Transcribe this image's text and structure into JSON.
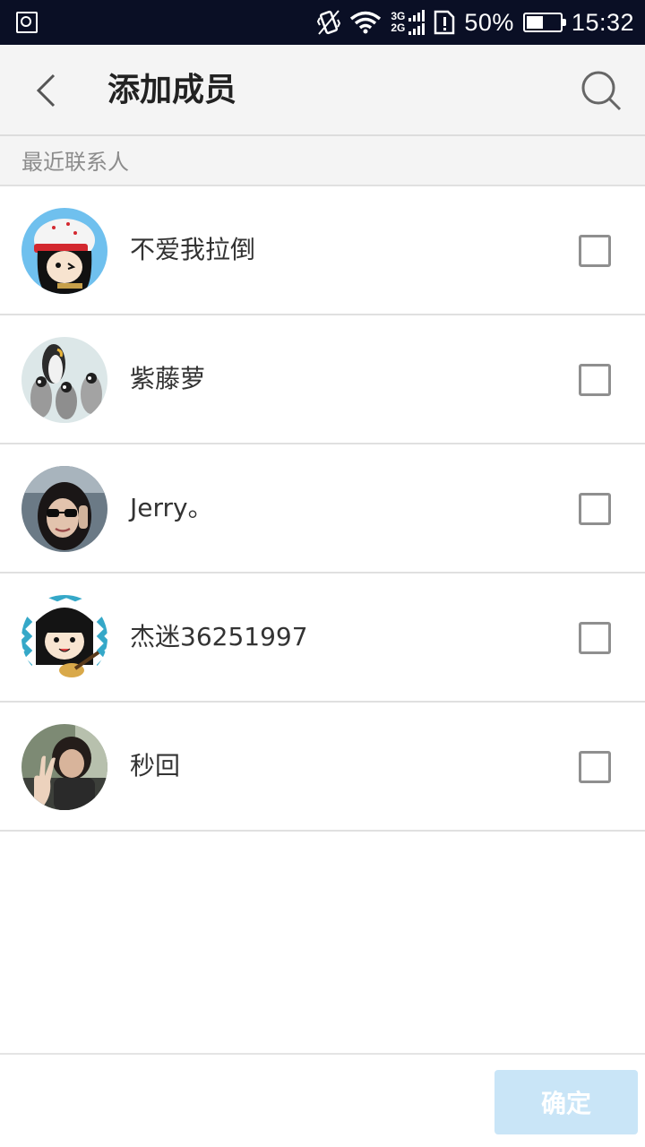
{
  "status_bar": {
    "network_top": "3G",
    "network_bottom": "2G",
    "battery": "50%",
    "time": "15:32",
    "battery_level": 0.5,
    "icons": [
      "gallery-icon",
      "vibrate-icon",
      "wifi-icon",
      "signal-icon",
      "sim-alert-icon",
      "battery-icon"
    ]
  },
  "app_bar": {
    "title": "添加成员",
    "back_icon": "chevron-left-icon",
    "search_icon": "search-icon"
  },
  "section": {
    "label": "最近联系人"
  },
  "contacts": [
    {
      "name": "不爱我拉倒",
      "checked": false,
      "avatar": "cartoon-girl-red-cap-avatar"
    },
    {
      "name": "紫藤萝",
      "checked": false,
      "avatar": "penguins-avatar"
    },
    {
      "name": "Jerry。",
      "checked": false,
      "avatar": "girl-sunglasses-photo-avatar"
    },
    {
      "name": "杰迷36251997",
      "checked": false,
      "avatar": "cartoon-girl-guitar-avatar"
    },
    {
      "name": "秒回",
      "checked": false,
      "avatar": "peace-sign-photo-avatar"
    }
  ],
  "footer": {
    "confirm_label": "确定"
  },
  "colors": {
    "status_bar_bg": "#0a0f25",
    "app_bar_bg": "#f4f4f4",
    "confirm_disabled_bg": "#c9e5f7"
  }
}
